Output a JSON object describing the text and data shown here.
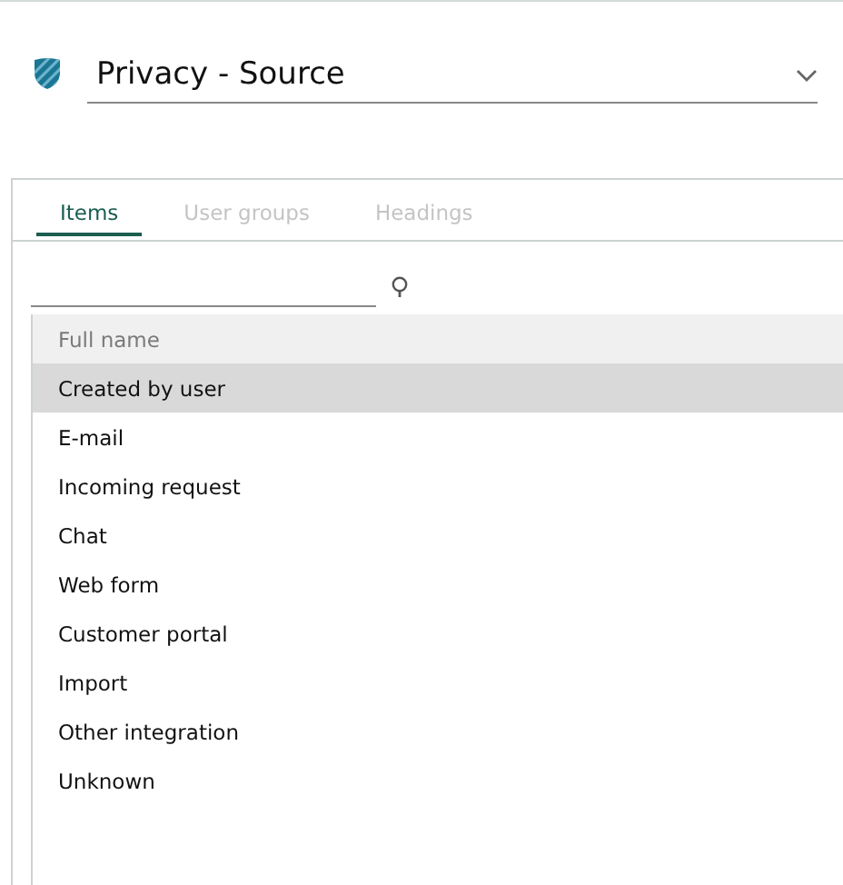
{
  "title": "Privacy - Source",
  "tabs": [
    {
      "label": "Items",
      "selected": true
    },
    {
      "label": "User groups",
      "selected": false
    },
    {
      "label": "Headings",
      "selected": false
    }
  ],
  "table": {
    "columns": [
      "Full name"
    ],
    "rows": [
      {
        "cells": [
          "Created by user"
        ],
        "selected": true
      },
      {
        "cells": [
          "E-mail"
        ],
        "selected": false
      },
      {
        "cells": [
          "Incoming request"
        ],
        "selected": false
      },
      {
        "cells": [
          "Chat"
        ],
        "selected": false
      },
      {
        "cells": [
          "Web form"
        ],
        "selected": false
      },
      {
        "cells": [
          "Customer portal"
        ],
        "selected": false
      },
      {
        "cells": [
          "Import"
        ],
        "selected": false
      },
      {
        "cells": [
          "Other integration"
        ],
        "selected": false
      },
      {
        "cells": [
          "Unknown"
        ],
        "selected": false
      }
    ]
  }
}
